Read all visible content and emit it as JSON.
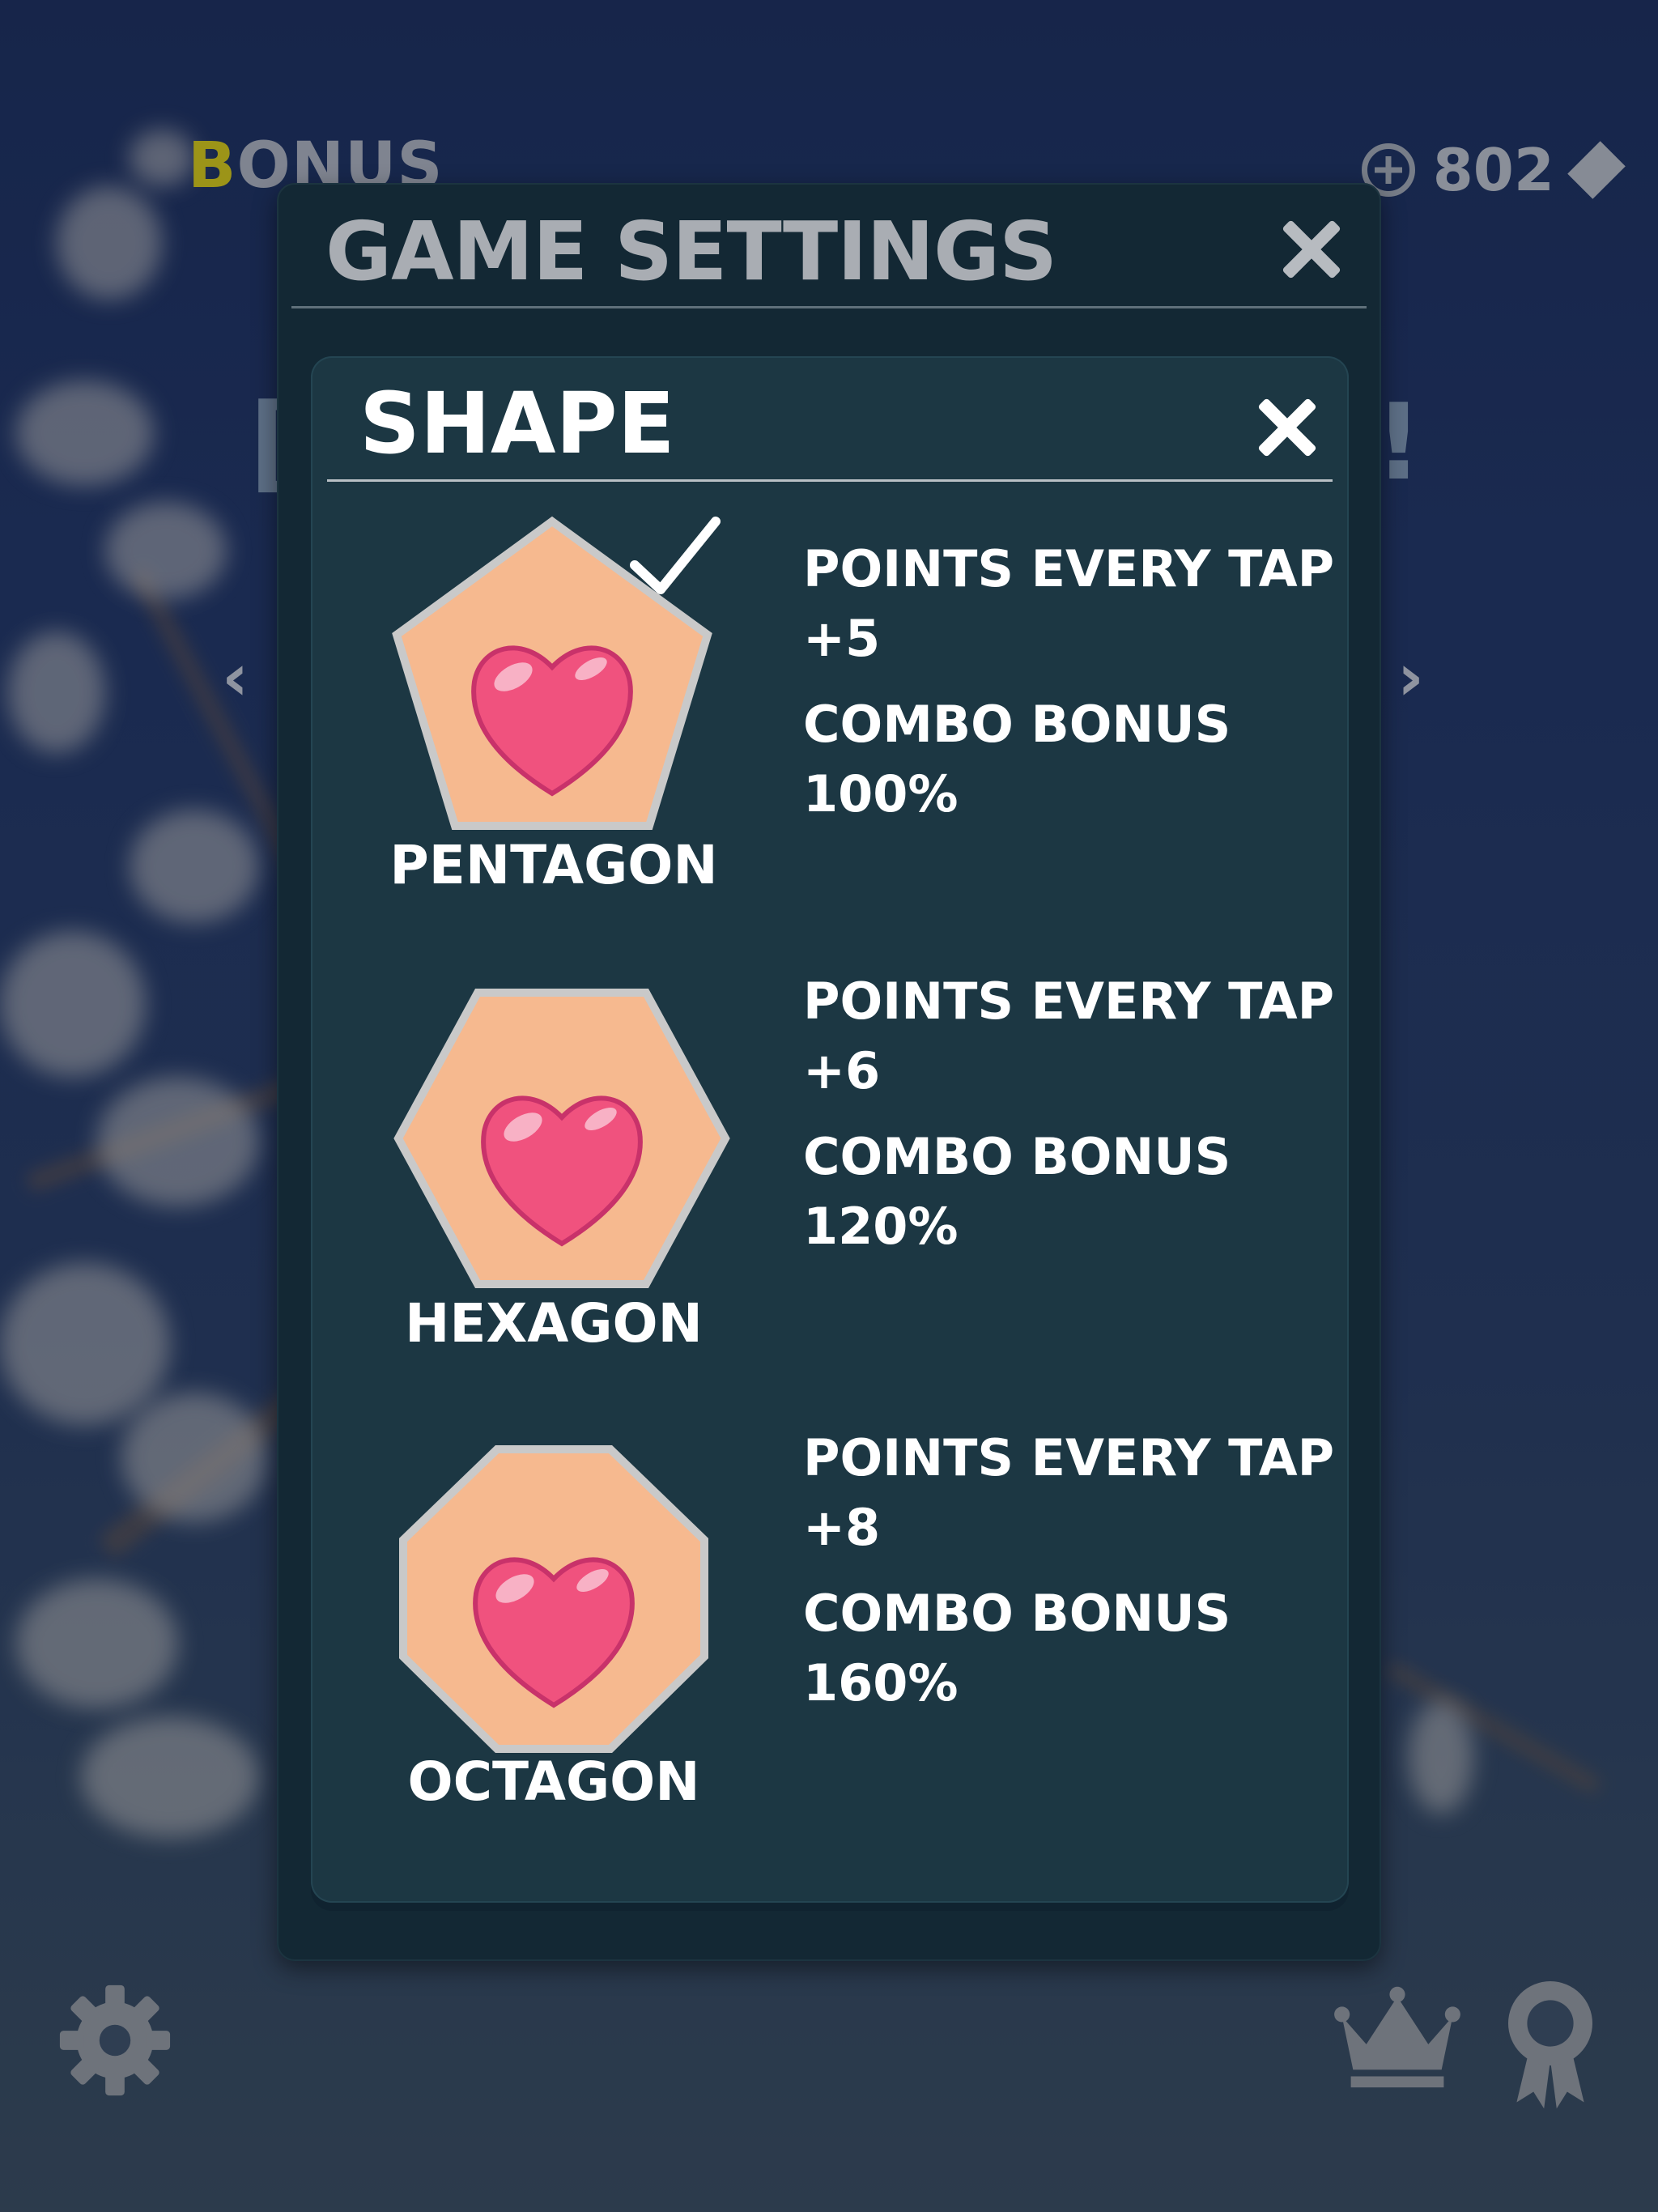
{
  "hud": {
    "bonus_first_letter": "B",
    "bonus_rest": "ONUS",
    "coin_count": "802",
    "left_arrow": "‹",
    "right_arrow": "›",
    "bracket_left": "[",
    "bracket_right": "!"
  },
  "dialog": {
    "title": "GAME SETTINGS"
  },
  "panel": {
    "title": "SHAPE"
  },
  "shapes": [
    {
      "name": "PENTAGON",
      "points_label": "POINTS EVERY TAP",
      "points_value": "+5",
      "combo_label": "COMBO BONUS",
      "combo_value": "100%",
      "selected": true
    },
    {
      "name": "HEXAGON",
      "points_label": "POINTS EVERY TAP",
      "points_value": "+6",
      "combo_label": "COMBO BONUS",
      "combo_value": "120%",
      "selected": false
    },
    {
      "name": "OCTAGON",
      "points_label": "POINTS EVERY TAP",
      "points_value": "+8",
      "combo_label": "COMBO BONUS",
      "combo_value": "160%",
      "selected": false
    }
  ],
  "icons": {
    "dialog_close": "close-icon",
    "panel_close": "close-icon",
    "selected_mark": "checkmark-icon",
    "shape_content": "heart-icon",
    "settings": "gear-icon",
    "leaderboard": "crown-icon",
    "achievements": "medal-icon",
    "add_coins": "plus-circle-icon",
    "currency": "diamond-icon"
  },
  "colors": {
    "shape_fill": "#f6b98f",
    "shape_border": "#c9c9c9",
    "heart": "#f0527e",
    "panel": "#1c3743",
    "dialog": "#132834",
    "bonus_accent": "#9c9418"
  }
}
